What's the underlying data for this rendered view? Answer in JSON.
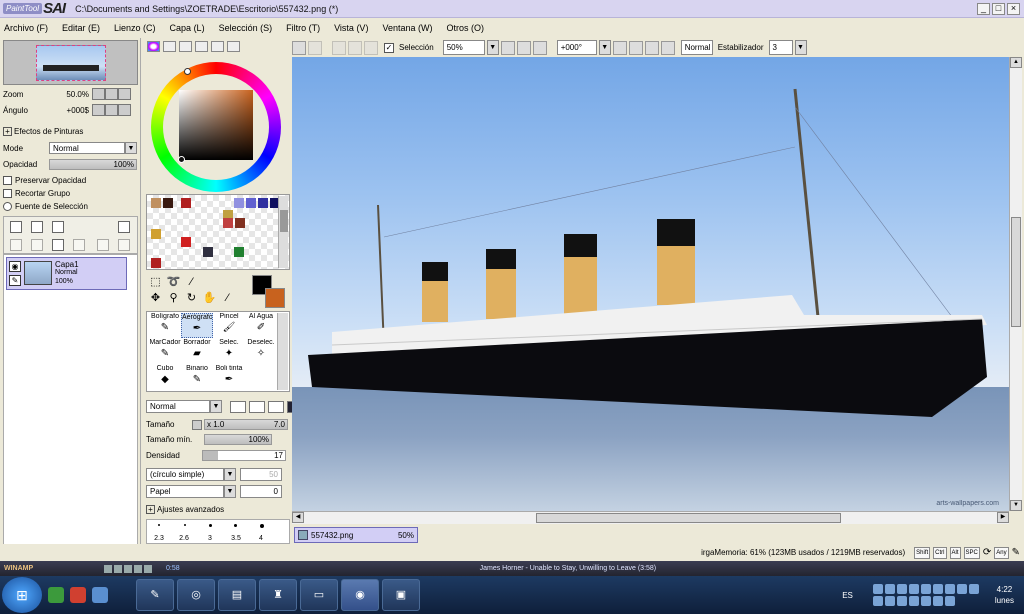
{
  "app": {
    "logo_small": "PaintTool",
    "logo_big": "SAI",
    "title": "C:\\Documents and Settings\\ZOETRADE\\Escritorio\\557432.png (*)"
  },
  "window_buttons": {
    "minimize": "_",
    "maximize": "□",
    "close": "×"
  },
  "menu": [
    "Archivo (F)",
    "Editar (E)",
    "Lienzo (C)",
    "Capa (L)",
    "Selección (S)",
    "Filtro (T)",
    "Vista (V)",
    "Ventana (W)",
    "Otros (O)"
  ],
  "toolbar": {
    "selection_label": "Selección",
    "selection_checked": true,
    "zoom": "50%",
    "rotation": "+000°",
    "blend": "Normal",
    "stabilizer_label": "Estabilizador",
    "stabilizer_value": "3"
  },
  "navigator": {
    "zoom_label": "Zoom",
    "zoom_value": "50.0%",
    "angle_label": "Ángulo",
    "angle_value": "+000$"
  },
  "layer_panel": {
    "effects_label": "Efectos de Pinturas",
    "mode_label": "Mode",
    "mode_value": "Normal",
    "opacity_label": "Opacidad",
    "opacity_value": "100%",
    "checks": [
      {
        "label": "Preservar Opacidad",
        "checked": false
      },
      {
        "label": "Recortar Grupo",
        "checked": false
      },
      {
        "label": "Fuente de Selección",
        "checked": false
      }
    ],
    "layers": [
      {
        "name": "Capa1",
        "mode": "Normal",
        "opacity": "100%"
      }
    ]
  },
  "brushes": [
    {
      "label": "Bolígrafo",
      "icon": "pen-icon",
      "glyph": "✎"
    },
    {
      "label": "Aerógrafo",
      "icon": "airbrush-icon",
      "glyph": "✒",
      "selected": true
    },
    {
      "label": "Pincel",
      "icon": "brush-icon",
      "glyph": "🖌"
    },
    {
      "label": "Al Agua",
      "icon": "watercolor-icon",
      "glyph": "✐"
    },
    {
      "label": "MarCador",
      "icon": "marker-icon",
      "glyph": "✎"
    },
    {
      "label": "Borrador",
      "icon": "eraser-icon",
      "glyph": "▰"
    },
    {
      "label": "Selec.",
      "icon": "select-brush-icon",
      "glyph": "✦"
    },
    {
      "label": "Deselec.",
      "icon": "deselect-brush-icon",
      "glyph": "✧"
    },
    {
      "label": "Cubo",
      "icon": "bucket-icon",
      "glyph": "◆"
    },
    {
      "label": "Binario",
      "icon": "binary-pen-icon",
      "glyph": "✎"
    },
    {
      "label": "Boli tinta",
      "icon": "ink-pen-icon",
      "glyph": "✒"
    }
  ],
  "brush_props": {
    "blend": "Normal",
    "size_label": "Tamaño",
    "size_mult": "x 1.0",
    "size_value": "7.0",
    "min_size_label": "Tamaño mín.",
    "min_size_value": "100%",
    "density_label": "Densidad",
    "density_value": "17",
    "shape": "(círculo simple)",
    "shape_value": "50",
    "texture": "Papel",
    "texture_value": "0",
    "advanced_label": "Ajustes avanzados",
    "sizes": [
      "2.3",
      "2.6",
      "3",
      "3.5",
      "4"
    ]
  },
  "canvas": {
    "watermark": "arts-wallpapers.com"
  },
  "colors": {
    "foreground": "#000000",
    "background": "#c8621e",
    "swatches": [
      "#c09060",
      "#3a1a10",
      "#b02020",
      "#9090e0",
      "#6060d0",
      "#3030a0",
      "#101060",
      "#c0a040",
      "#c04040",
      "#803020",
      "#d02020",
      "#303040",
      "#208030",
      "#d0a030",
      "#b02020"
    ]
  },
  "document": {
    "tab_name": "557432.png",
    "tab_zoom": "50%"
  },
  "status": {
    "memory": "irgaMemoria: 61% (123MB usados / 1219MB reservados)",
    "keys": [
      "Shift",
      "Ctrl",
      "Alt",
      "SPC",
      "Any"
    ]
  },
  "winamp": {
    "logo": "WINAMP",
    "time": "0:58",
    "track": "James Horner - Unable to Stay, Unwilling to Leave (3:58)"
  },
  "taskbar": {
    "language": "ES",
    "time": "4:22",
    "day": "lunes"
  }
}
